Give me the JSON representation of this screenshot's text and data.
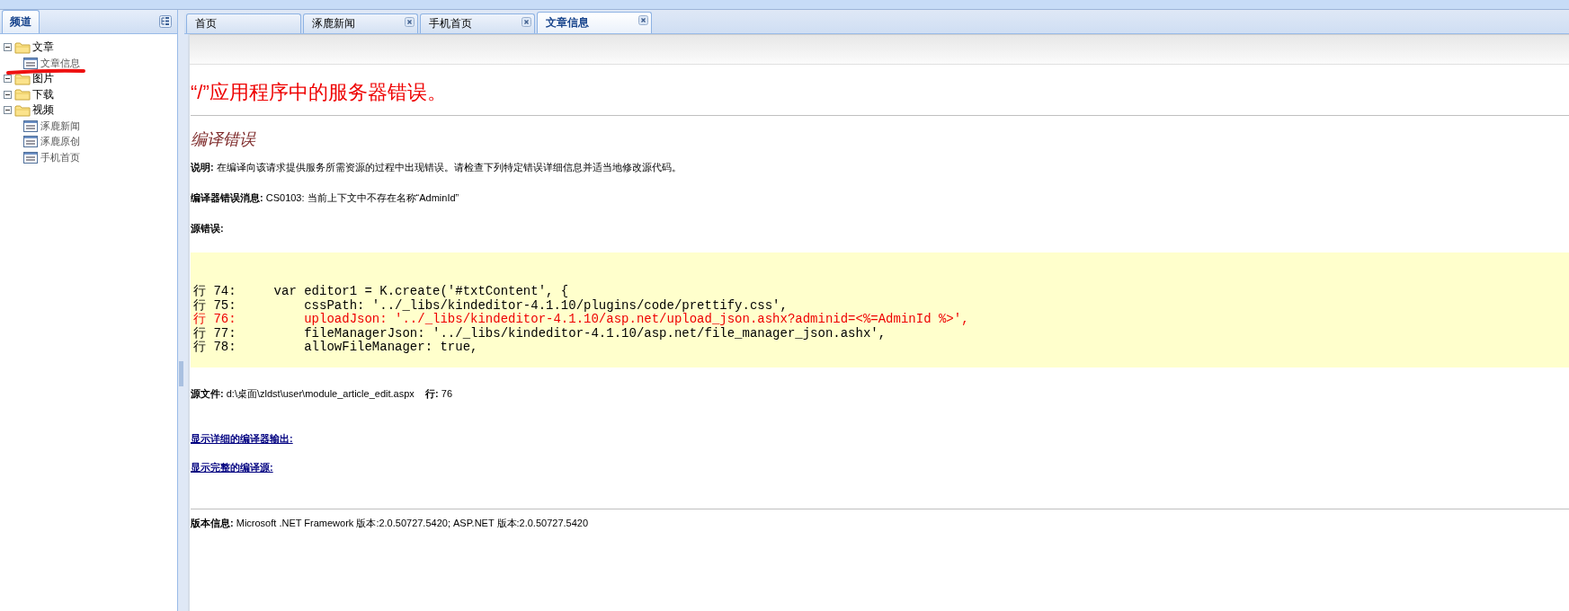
{
  "sidebar": {
    "title": "频道",
    "tree": [
      {
        "label": "文章",
        "kind": "folder",
        "expanded": true,
        "children": [
          {
            "label": "文章信息",
            "kind": "page"
          }
        ]
      },
      {
        "label": "图片",
        "kind": "folder",
        "expanded": true
      },
      {
        "label": "下载",
        "kind": "folder",
        "expanded": true
      },
      {
        "label": "视频",
        "kind": "folder",
        "expanded": true,
        "children": [
          {
            "label": "涿鹿新闻",
            "kind": "page"
          },
          {
            "label": "涿鹿原创",
            "kind": "page"
          },
          {
            "label": "手机首页",
            "kind": "page"
          }
        ]
      }
    ]
  },
  "tabs": [
    {
      "label": "首页",
      "selected": false,
      "closable": false
    },
    {
      "label": "涿鹿新闻",
      "selected": false,
      "closable": true
    },
    {
      "label": "手机首页",
      "selected": false,
      "closable": true
    },
    {
      "label": "文章信息",
      "selected": true,
      "closable": true
    }
  ],
  "error_page": {
    "title": "“/”应用程序中的服务器错误。",
    "subtitle": "编译错误",
    "description": "**说明:** 在编译向该请求提供服务所需资源的过程中出现错误。请检查下列特定错误详细信息并适当地修改源代码。",
    "compiler_message": "**编译器错误消息:** CS0103: 当前上下文中不存在名称“AdminId”",
    "source_error_label": "源错误:",
    "code_lines": [
      {
        "text": "行 74:     var editor1 = K.create('#txtContent', {",
        "error": false
      },
      {
        "text": "行 75:         cssPath: '../_libs/kindeditor-4.1.10/plugins/code/prettify.css',",
        "error": false
      },
      {
        "text": "行 76:         uploadJson: '../_libs/kindeditor-4.1.10/asp.net/upload_json.ashx?adminid=<%=AdminId %>',",
        "error": true
      },
      {
        "text": "行 77:         fileManagerJson: '../_libs/kindeditor-4.1.10/asp.net/file_manager_json.ashx',",
        "error": false
      },
      {
        "text": "行 78:         allowFileManager: true,",
        "error": false
      }
    ],
    "source_file": "**源文件:** d:\\桌面\\zldst\\user\\module_article_edit.aspx    **行:** 76",
    "links": [
      "显示详细的编译器输出:",
      "显示完整的编译源:"
    ],
    "version": "**版本信息:** Microsoft .NET Framework 版本:2.0.50727.5420; ASP.NET 版本:2.0.50727.5420"
  }
}
